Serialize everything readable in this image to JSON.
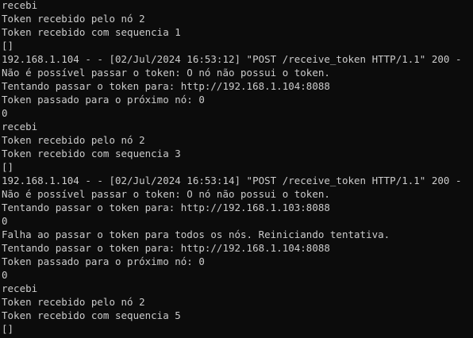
{
  "terminal": {
    "lines": [
      "recebi",
      "Token recebido pelo nó 2",
      "Token recebido com sequencia 1",
      "[]",
      "192.168.1.104 - - [02/Jul/2024 16:53:12] \"POST /receive_token HTTP/1.1\" 200 -",
      "Não é possível passar o token: O nó não possui o token.",
      "Tentando passar o token para: http://192.168.1.104:8088",
      "Token passado para o próximo nó: 0",
      "0",
      "recebi",
      "Token recebido pelo nó 2",
      "Token recebido com sequencia 3",
      "[]",
      "192.168.1.104 - - [02/Jul/2024 16:53:14] \"POST /receive_token HTTP/1.1\" 200 -",
      "Não é possível passar o token: O nó não possui o token.",
      "Tentando passar o token para: http://192.168.1.103:8088",
      "0",
      "Falha ao passar o token para todos os nós. Reiniciando tentativa.",
      "Tentando passar o token para: http://192.168.1.104:8088",
      "Token passado para o próximo nó: 0",
      "0",
      "recebi",
      "Token recebido pelo nó 2",
      "Token recebido com sequencia 5",
      "[]"
    ]
  }
}
